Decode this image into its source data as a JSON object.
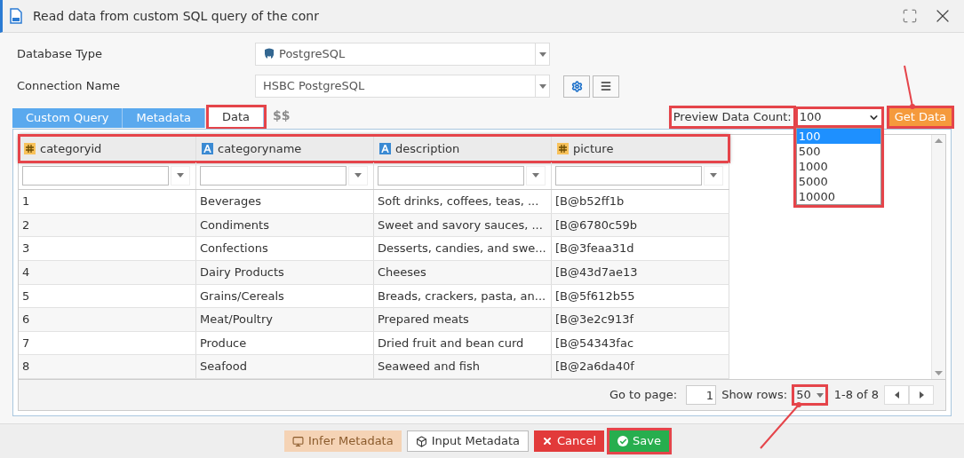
{
  "window": {
    "title": "Read data from custom SQL query of the conr"
  },
  "form": [
    {
      "label": "Database Type",
      "value": "PostgreSQL",
      "kind": "database"
    },
    {
      "label": "Connection Name",
      "value": "HSBC PostgreSQL",
      "kind": "connection"
    }
  ],
  "tabs": [
    {
      "label": "Custom Query",
      "selected": false,
      "highlighted": false
    },
    {
      "label": "Metadata",
      "selected": false,
      "highlighted": false
    },
    {
      "label": "Data",
      "selected": true,
      "highlighted": true
    }
  ],
  "tab_extra": "$$",
  "preview": {
    "label": "Preview Data Count:",
    "value": "100",
    "options": [
      {
        "label": "100",
        "selected": true
      },
      {
        "label": "500",
        "selected": false
      },
      {
        "label": "1000",
        "selected": false
      },
      {
        "label": "5000",
        "selected": false
      },
      {
        "label": "10000",
        "selected": false
      }
    ]
  },
  "get_data_button": "Get Data",
  "table": {
    "columns": [
      {
        "label": "categoryid",
        "kind": "number"
      },
      {
        "label": "categoryname",
        "kind": "text"
      },
      {
        "label": "description",
        "kind": "text"
      },
      {
        "label": "picture",
        "kind": "number"
      }
    ],
    "rows": [
      [
        "1",
        "Beverages",
        "Soft drinks, coffees, teas, ...",
        "[B@b52ff1b"
      ],
      [
        "2",
        "Condiments",
        "Sweet and savory sauces, ...",
        "[B@6780c59b"
      ],
      [
        "3",
        "Confections",
        "Desserts, candies, and swe...",
        "[B@3feaa31d"
      ],
      [
        "4",
        "Dairy Products",
        "Cheeses",
        "[B@43d7ae13"
      ],
      [
        "5",
        "Grains/Cereals",
        "Breads, crackers, pasta, an...",
        "[B@5f612b55"
      ],
      [
        "6",
        "Meat/Poultry",
        "Prepared meats",
        "[B@3e2c913f"
      ],
      [
        "7",
        "Produce",
        "Dried fruit and bean curd",
        "[B@54343fac"
      ],
      [
        "8",
        "Seafood",
        "Seaweed and fish",
        "[B@2a6da40f"
      ]
    ]
  },
  "pagination": {
    "go_to_label": "Go to page:",
    "page": "1",
    "rows_label": "Show rows:",
    "rows_value": "50",
    "range": "1-8 of 8"
  },
  "buttons": [
    {
      "label": "Infer Metadata",
      "kind": "infer",
      "disabled": true,
      "highlighted": false
    },
    {
      "label": "Input Metadata",
      "kind": "input",
      "disabled": false,
      "highlighted": false
    },
    {
      "label": "Cancel",
      "kind": "cancel",
      "disabled": false,
      "highlighted": false
    },
    {
      "label": "Save",
      "kind": "save",
      "disabled": false,
      "highlighted": true
    }
  ]
}
